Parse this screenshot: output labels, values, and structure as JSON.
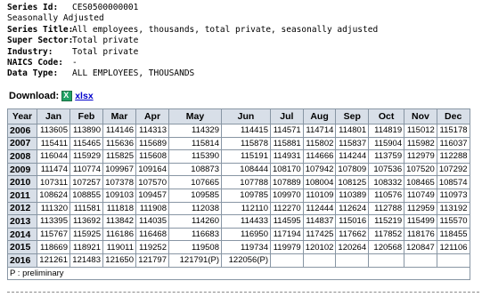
{
  "series_info": [
    {
      "label": "Series Id:",
      "value": "CES0500000001",
      "bold": true
    },
    {
      "label": "Seasonally Adjusted",
      "value": "",
      "bold": false
    },
    {
      "label": "Series Title:",
      "value": "All employees, thousands, total private, seasonally adjusted",
      "bold": true
    },
    {
      "label": "Super Sector:",
      "value": "Total private",
      "bold": true
    },
    {
      "label": "Industry:",
      "value": "Total private",
      "bold": true
    },
    {
      "label": "NAICS Code:",
      "value": "-",
      "bold": true
    },
    {
      "label": "Data Type:",
      "value": "ALL EMPLOYEES, THOUSANDS",
      "bold": true
    }
  ],
  "download": {
    "label": "Download:",
    "link_text": "xlsx",
    "icon": "excel-icon"
  },
  "table": {
    "headers": [
      "Year",
      "Jan",
      "Feb",
      "Mar",
      "Apr",
      "May",
      "Jun",
      "Jul",
      "Aug",
      "Sep",
      "Oct",
      "Nov",
      "Dec"
    ],
    "rows": [
      {
        "year": "2006",
        "values": [
          "113605",
          "113890",
          "114146",
          "114313",
          "114329",
          "114415",
          "114571",
          "114714",
          "114801",
          "114819",
          "115012",
          "115178"
        ]
      },
      {
        "year": "2007",
        "values": [
          "115411",
          "115465",
          "115636",
          "115689",
          "115814",
          "115878",
          "115881",
          "115802",
          "115837",
          "115904",
          "115982",
          "116037"
        ]
      },
      {
        "year": "2008",
        "values": [
          "116044",
          "115929",
          "115825",
          "115608",
          "115390",
          "115191",
          "114931",
          "114666",
          "114244",
          "113759",
          "112979",
          "112288"
        ]
      },
      {
        "year": "2009",
        "values": [
          "111474",
          "110774",
          "109967",
          "109164",
          "108873",
          "108444",
          "108170",
          "107942",
          "107809",
          "107536",
          "107520",
          "107292"
        ]
      },
      {
        "year": "2010",
        "values": [
          "107311",
          "107257",
          "107378",
          "107570",
          "107665",
          "107788",
          "107889",
          "108004",
          "108125",
          "108332",
          "108465",
          "108574"
        ]
      },
      {
        "year": "2011",
        "values": [
          "108624",
          "108855",
          "109103",
          "109457",
          "109585",
          "109785",
          "109970",
          "110109",
          "110389",
          "110576",
          "110749",
          "110973"
        ]
      },
      {
        "year": "2012",
        "values": [
          "111320",
          "111581",
          "111818",
          "111908",
          "112038",
          "112110",
          "112270",
          "112444",
          "112624",
          "112788",
          "112959",
          "113192"
        ]
      },
      {
        "year": "2013",
        "values": [
          "113395",
          "113692",
          "113842",
          "114035",
          "114260",
          "114433",
          "114595",
          "114837",
          "115016",
          "115219",
          "115499",
          "115570"
        ]
      },
      {
        "year": "2014",
        "values": [
          "115767",
          "115925",
          "116186",
          "116468",
          "116683",
          "116950",
          "117194",
          "117425",
          "117662",
          "117852",
          "118176",
          "118455"
        ]
      },
      {
        "year": "2015",
        "values": [
          "118669",
          "118921",
          "119011",
          "119252",
          "119508",
          "119734",
          "119979",
          "120102",
          "120264",
          "120568",
          "120847",
          "121106"
        ]
      },
      {
        "year": "2016",
        "values": [
          "121261",
          "121483",
          "121650",
          "121797",
          "121791(P)",
          "122056(P)",
          "",
          "",
          "",
          "",
          "",
          ""
        ]
      }
    ],
    "footnote": "P : preliminary"
  }
}
